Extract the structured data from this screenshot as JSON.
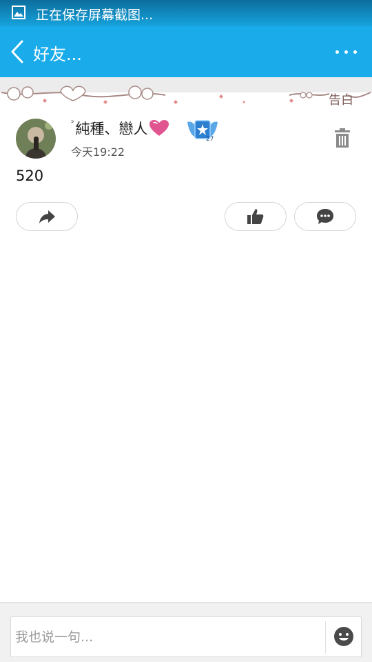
{
  "status_bar": {
    "icon": "image-icon",
    "text": "正在保存屏幕截图..."
  },
  "title_bar": {
    "back_icon": "chevron-left-icon",
    "title": "好友...",
    "more_icon": "more-dots-icon"
  },
  "banner": {
    "text": "告白"
  },
  "post": {
    "author": {
      "nickname_prefix": "ᵓ",
      "nickname": "純種、戀人",
      "heart_icon": "pink-heart-icon",
      "badge_icon": "vip-wings-badge-icon",
      "badge_level": "27"
    },
    "timestamp": "今天19:22",
    "content": "520",
    "delete_icon": "trash-icon",
    "actions": {
      "share_icon": "share-arrow-icon",
      "like_icon": "thumbs-up-icon",
      "comment_icon": "comment-bubble-icon"
    }
  },
  "comment_bar": {
    "placeholder": "我也说一句...",
    "emoji_icon": "smiley-face-icon"
  },
  "colors": {
    "status_bar": "#0c6e9e",
    "title_bar": "#1aabea",
    "text_primary": "#222222",
    "text_secondary": "#555555",
    "heart": "#e0558f"
  }
}
